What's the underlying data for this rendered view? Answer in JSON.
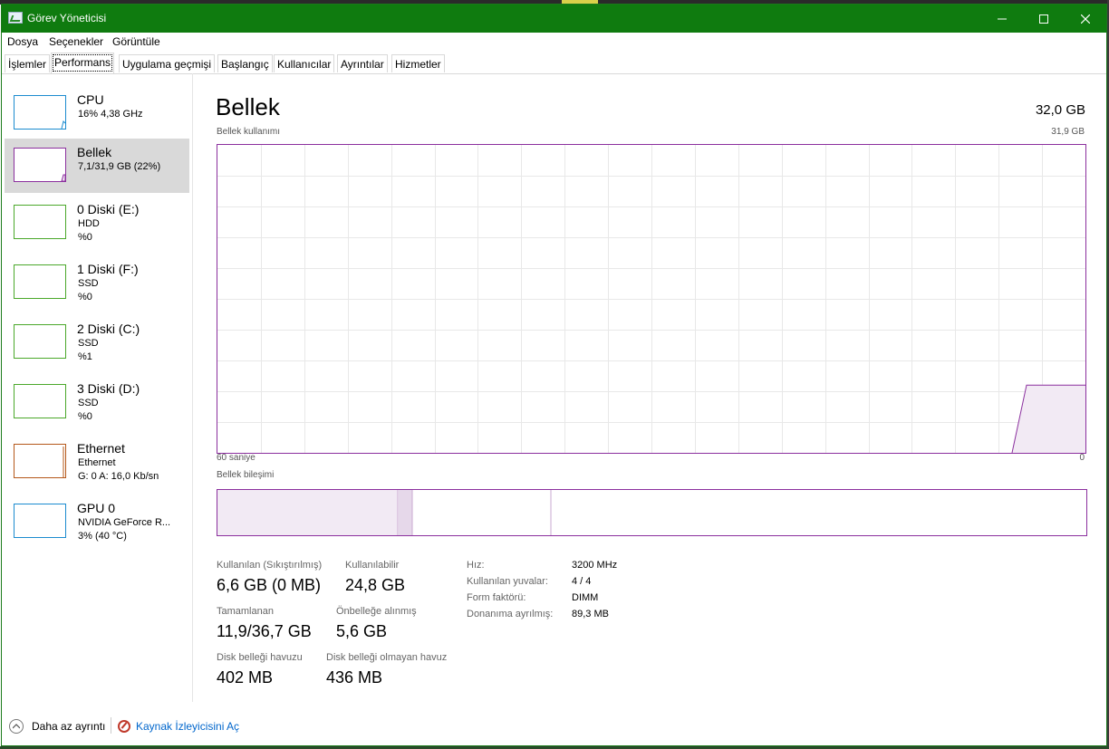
{
  "window": {
    "title": "Görev Yöneticisi"
  },
  "menu": [
    "Dosya",
    "Seçenekler",
    "Görüntüle"
  ],
  "tabs": [
    {
      "label": "İşlemler"
    },
    {
      "label": "Performans"
    },
    {
      "label": "Uygulama geçmişi"
    },
    {
      "label": "Başlangıç"
    },
    {
      "label": "Kullanıcılar"
    },
    {
      "label": "Ayrıntılar"
    },
    {
      "label": "Hizmetler"
    }
  ],
  "sidebar": [
    {
      "name": "CPU",
      "line1": "16% 4,38 GHz",
      "line2": "",
      "color": "#1b8bcf"
    },
    {
      "name": "Bellek",
      "line1": "7,1/31,9 GB (22%)",
      "line2": "",
      "color": "#8b2f9e"
    },
    {
      "name": "0 Diski (E:)",
      "line1": "HDD",
      "line2": "%0",
      "color": "#4aa82a"
    },
    {
      "name": "1 Diski (F:)",
      "line1": "SSD",
      "line2": "%0",
      "color": "#4aa82a"
    },
    {
      "name": "2 Diski (C:)",
      "line1": "SSD",
      "line2": "%1",
      "color": "#4aa82a"
    },
    {
      "name": "3 Diski (D:)",
      "line1": "SSD",
      "line2": "%0",
      "color": "#4aa82a"
    },
    {
      "name": "Ethernet",
      "line1": "Ethernet",
      "line2": "G: 0 A: 16,0 Kb/sn",
      "color": "#b5581a"
    },
    {
      "name": "GPU 0",
      "line1": "NVIDIA GeForce R...",
      "line2": "3% (40 °C)",
      "color": "#1b8bcf"
    }
  ],
  "main": {
    "title": "Bellek",
    "total": "32,0 GB",
    "graph_label": "Bellek kullanımı",
    "graph_max": "31,9 GB",
    "graph_left": "60 saniye",
    "graph_right": "0",
    "composition_label": "Bellek bileşimi"
  },
  "stats": {
    "in_use_label": "Kullanılan (Sıkıştırılmış)",
    "in_use_value": "6,6 GB (0 MB)",
    "available_label": "Kullanılabilir",
    "available_value": "24,8 GB",
    "committed_label": "Tamamlanan",
    "committed_value": "11,9/36,7 GB",
    "cached_label": "Önbelleğe alınmış",
    "cached_value": "5,6 GB",
    "paged_label": "Disk belleği havuzu",
    "paged_value": "402 MB",
    "nonpaged_label": "Disk belleği olmayan havuz",
    "nonpaged_value": "436 MB"
  },
  "specs": [
    {
      "label": "Hız:",
      "value": "3200 MHz"
    },
    {
      "label": "Kullanılan yuvalar:",
      "value": "4 / 4"
    },
    {
      "label": "Form faktörü:",
      "value": "DIMM"
    },
    {
      "label": "Donanıma ayrılmış:",
      "value": "89,3 MB"
    }
  ],
  "footer": {
    "fewer_details": "Daha az ayrıntı",
    "resource_monitor": "Kaynak İzleyicisini Aç"
  },
  "colors": {
    "titlebar": "#0f7b0f",
    "memory": "#8b2f9e",
    "link": "#0066cc"
  },
  "memory_usage_fraction": 0.22
}
